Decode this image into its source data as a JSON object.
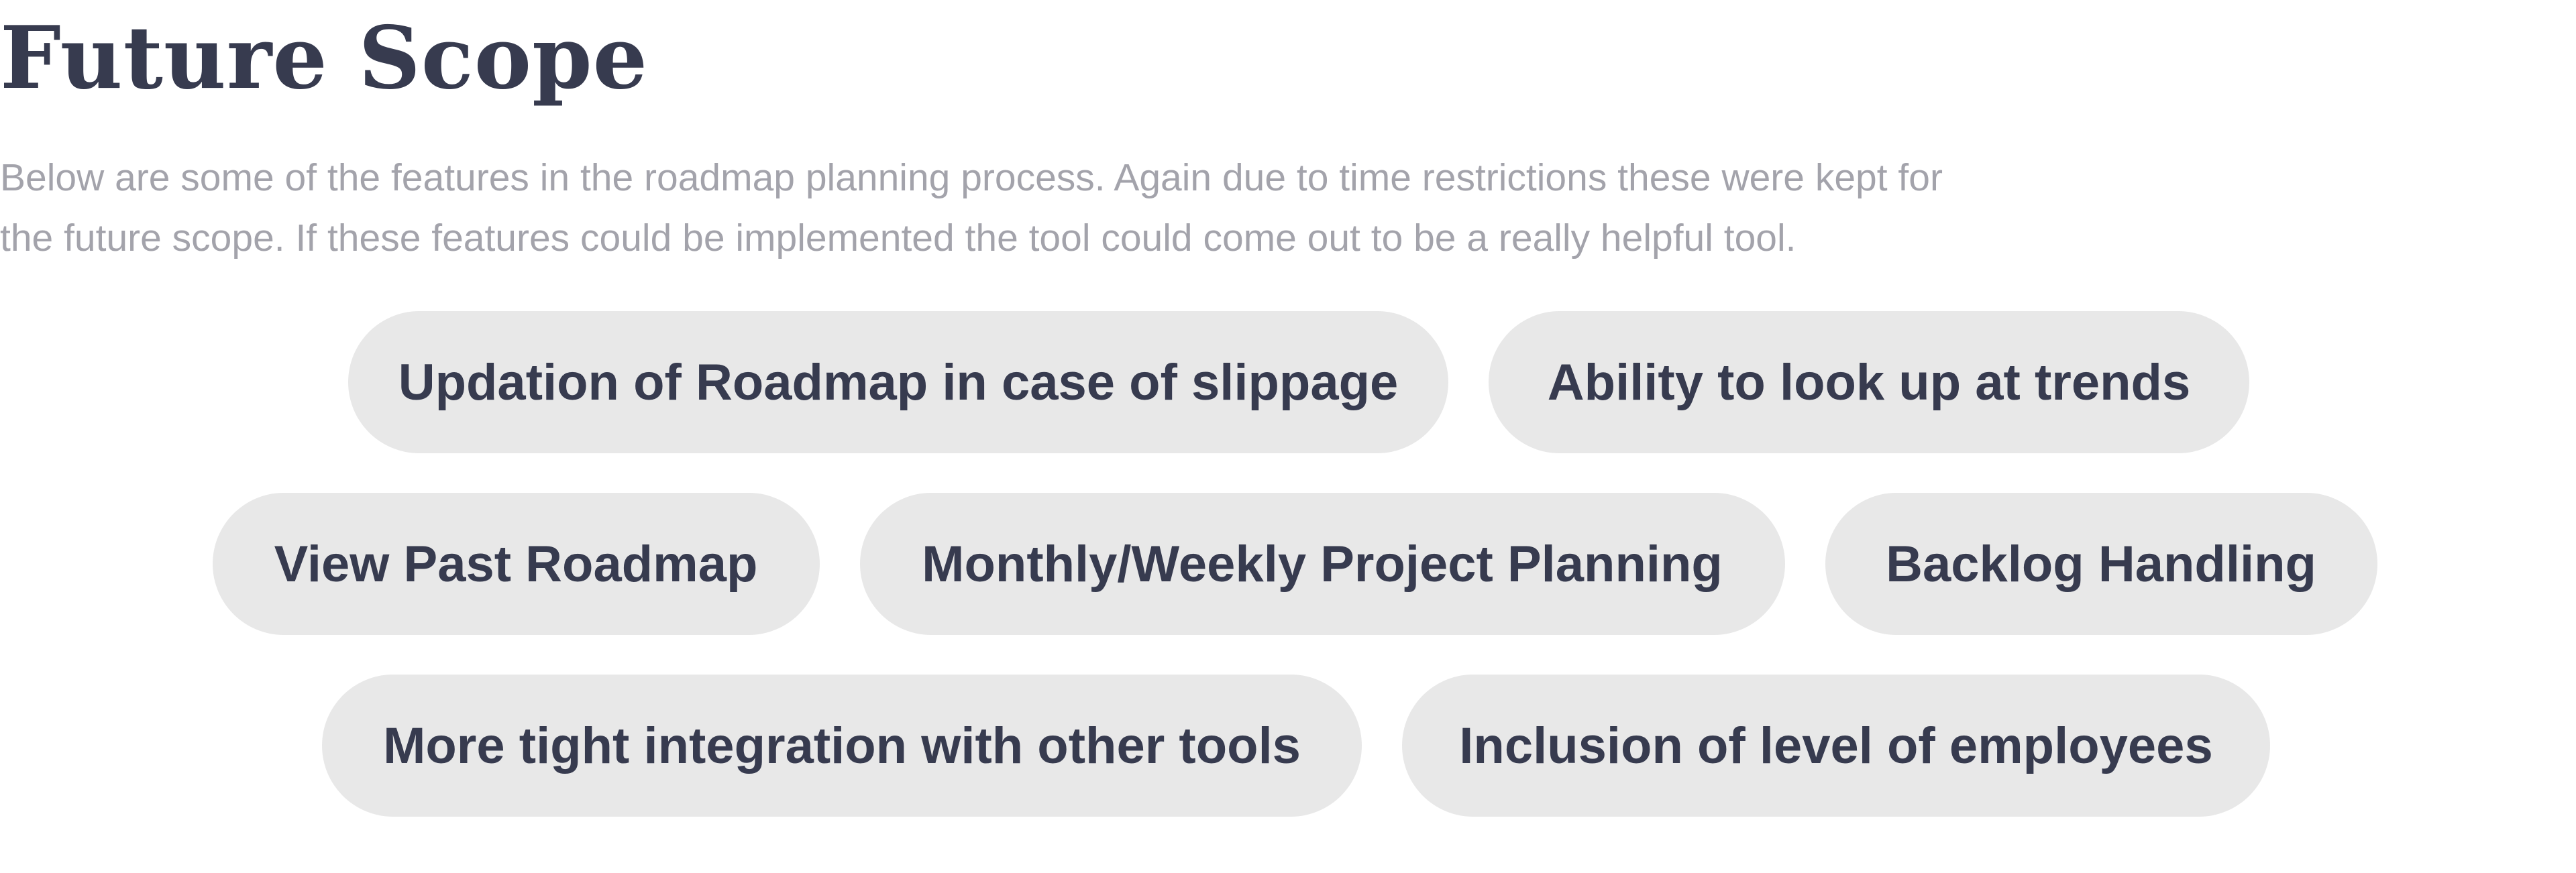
{
  "title": "Future Scope",
  "intro": {
    "line1": "Below are some of the features in the roadmap planning process. Again due to time restrictions these were kept for",
    "line2": "the future scope. If these features could be implemented the tool could come out to be a really helpful tool."
  },
  "features": [
    "Updation of Roadmap in case of slippage",
    "Ability to look up at trends",
    "View Past Roadmap",
    "Monthly/Weekly Project Planning",
    "Backlog Handling",
    "More tight integration with other tools",
    "Inclusion of level of employees"
  ],
  "colors": {
    "title": "#373b4f",
    "body_text": "#a3a3ab",
    "pill_bg": "#e8e8e8",
    "pill_text": "#373b4f"
  }
}
